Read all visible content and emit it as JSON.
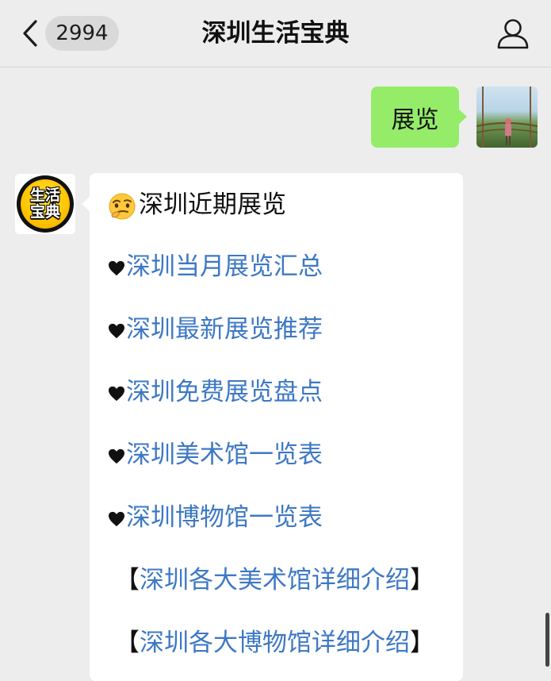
{
  "header": {
    "back_icon": "chevron-left-icon",
    "unread_count": "2994",
    "title": "深圳生活宝典",
    "profile_icon": "person-icon"
  },
  "chat": {
    "outgoing": {
      "text": "展览",
      "bubble_color": "#95ec69",
      "avatar": "user-photo"
    },
    "incoming": {
      "avatar_logo": {
        "line1": "生活",
        "line2": "宝典"
      },
      "heading_emoji": "thinking-face-icon",
      "heading": "深圳近期展览",
      "link_color": "#3d78c4",
      "links": [
        {
          "icon": "black-heart-icon",
          "text": "深圳当月展览汇总"
        },
        {
          "icon": "black-heart-icon",
          "text": "深圳最新展览推荐"
        },
        {
          "icon": "black-heart-icon",
          "text": "深圳免费展览盘点"
        },
        {
          "icon": "black-heart-icon",
          "text": "深圳美术馆一览表"
        },
        {
          "icon": "black-heart-icon",
          "text": "深圳博物馆一览表"
        }
      ],
      "bracket_links": [
        {
          "open": "【",
          "text": "深圳各大美术馆详细介绍",
          "close": "】"
        },
        {
          "open": "【",
          "text": "深圳各大博物馆详细介绍",
          "close": "】"
        }
      ]
    }
  }
}
